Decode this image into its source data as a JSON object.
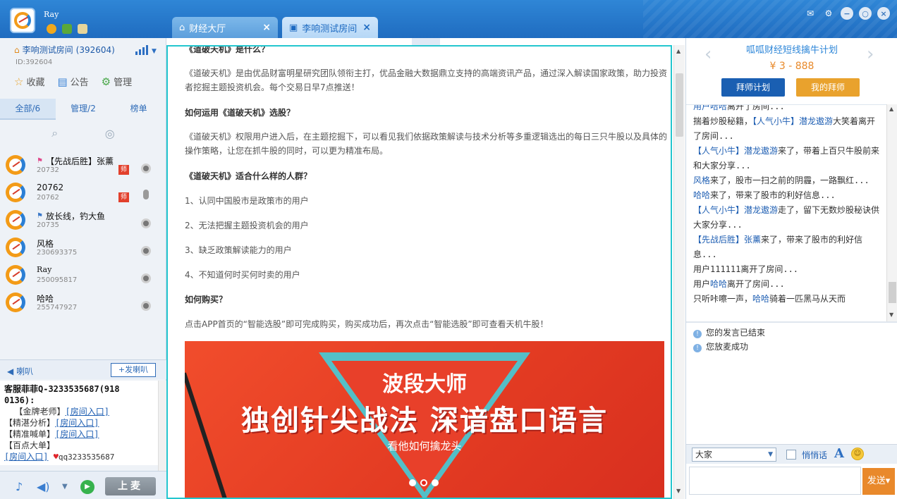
{
  "header": {
    "username": "Ray",
    "tabs": [
      {
        "label": "财经大厅",
        "icon": "home-icon"
      },
      {
        "label": "李响测试房间",
        "icon": "video-icon"
      }
    ]
  },
  "room": {
    "title": "李响测试房间",
    "number": "(392604)",
    "id_text": "ID:392604",
    "actions": [
      {
        "label": "收藏",
        "icon": "star-icon"
      },
      {
        "label": "公告",
        "icon": "document-icon"
      },
      {
        "label": "管理",
        "icon": "gear-icon"
      }
    ],
    "tabs": [
      "全部/6",
      "管理/2",
      "榜单"
    ]
  },
  "users": [
    {
      "name": "【先战后胜】张薰",
      "id": "20732",
      "flag": "pink-flag-icon",
      "badge": "师",
      "device": "camera-icon"
    },
    {
      "name": "20762",
      "id": "20762",
      "flag": "",
      "badge": "师",
      "device": "microphone-icon"
    },
    {
      "name": "放长线，钓大鱼",
      "id": "20735",
      "flag": "blue-flag-icon",
      "badge": "",
      "device": "camera-icon"
    },
    {
      "name": "风格",
      "id": "230693375",
      "flag": "",
      "badge": "",
      "device": "camera-icon"
    },
    {
      "name": "Ray",
      "id": "250095817",
      "flag": "",
      "badge": "",
      "device": "camera-icon"
    },
    {
      "name": "哈哈",
      "id": "255747927",
      "flag": "",
      "badge": "",
      "device": "camera-icon"
    }
  ],
  "horn": {
    "label": "喇叭",
    "button": "+发喇叭",
    "line1": "客服菲菲Q-3233535687(918",
    "line2": "0136):",
    "seg1": "【金牌老师】",
    "link1": "[房间入口]",
    "seg2": "【精湛分析】",
    "link2": "[房间入口]",
    "seg3": "【精准喊单】",
    "link3": "[房间入口]",
    "seg4": "【百点大单】",
    "link4": "[房间入口]",
    "qq": "qq3233535687"
  },
  "bottom": {
    "mic_button": "上麦"
  },
  "article": {
    "q1": "《道破天机》是什么？",
    "p1": "《道破天机》是由优品财富明星研究团队领衔主打，优品金融大数据鼎立支持的高端资讯产品，通过深入解读国家政策，助力投资者挖掘主题投资机会。每个交易日早7点推送！",
    "q2": "如何运用《道破天机》选股？",
    "p2": "《道破天机》权限用户进入后，在主题挖掘下，可以看见我们依据政策解读与技术分析等多重逻辑选出的每日三只牛股以及具体的操作策略，让您在抓牛股的同时，可以更为精准布局。",
    "q3": "《道破天机》适合什么样的人群？",
    "list": [
      "1、认同中国股市是政策市的用户",
      "2、无法把握主题投资机会的用户",
      "3、缺乏政策解读能力的用户",
      "4、不知道何时买何时卖的用户"
    ],
    "q4": "如何购买？",
    "p4": "点击APP首页的“智能选股”即可完成购买，购买成功后，再次点击“智能选股”即可查看天机牛股！"
  },
  "banner": {
    "title": "波段大师",
    "slogan": "独创针尖战法 深谙盘口语言",
    "sub": "看他如何擒龙头"
  },
  "plan": {
    "title": "呱呱财经短线擒牛计划",
    "price": "¥ 3 - 888",
    "btn_left": "拜师计划",
    "btn_right": "我的拜师"
  },
  "chat": [
    {
      "pre": "",
      "name": "用户哈哈",
      "text": "离开了房间..."
    },
    {
      "pre": "揣着炒股秘籍，",
      "name": "【人气小牛】潜龙遨游",
      "text": "大笑着离开了房间..."
    },
    {
      "pre": "",
      "name": "【人气小牛】潜龙遨游",
      "text": "来了，带着上百只牛股前来和大家分享..."
    },
    {
      "pre": "",
      "name": "风格",
      "text": "来了，股市一扫之前的阴霾，一路飘红..."
    },
    {
      "pre": "",
      "name": "哈哈",
      "text": "来了，带来了股市的利好信息..."
    },
    {
      "pre": "",
      "name": "【人气小牛】潜龙遨游",
      "text": "走了，留下无数炒股秘诀供大家分享..."
    },
    {
      "pre": "",
      "name": "【先战后胜】张薰",
      "text": "来了，带来了股市的利好信息..."
    },
    {
      "pre": "用户111111",
      "name": "",
      "text": "离开了房间..."
    },
    {
      "pre": "用户",
      "name": "哈哈",
      "text": "离开了房间..."
    },
    {
      "pre": "只听咔嚓一声，",
      "name": "哈哈",
      "text": "骑着一匹黑马从天而"
    }
  ],
  "system": [
    "您的发言已结束",
    "您放麦成功"
  ],
  "input": {
    "target": "大家",
    "whisper": "悄悄话",
    "font_icon": "A",
    "send": "发送▾"
  }
}
